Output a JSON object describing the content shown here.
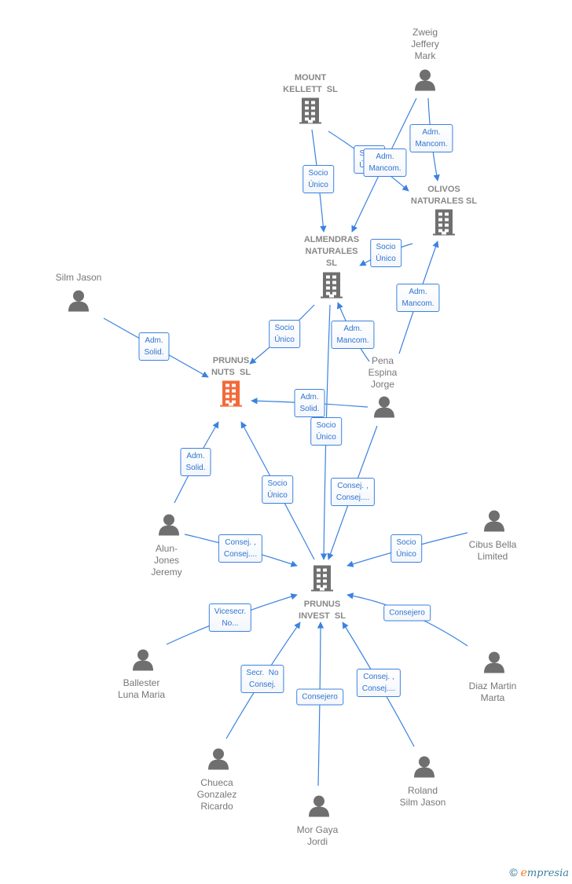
{
  "nodes": [
    {
      "id": "zweig",
      "label": "Zweig\nJeffery\nMark",
      "type": "person"
    },
    {
      "id": "kellett",
      "label": "MOUNT\nKELLETT  SL",
      "type": "company"
    },
    {
      "id": "olivos",
      "label": "OLIVOS\nNATURALES SL",
      "type": "company"
    },
    {
      "id": "almendras",
      "label": "ALMENDRAS\nNATURALES\nSL",
      "type": "company"
    },
    {
      "id": "silm",
      "label": "Silm Jason",
      "type": "person"
    },
    {
      "id": "nuts",
      "label": "PRUNUS\nNUTS  SL",
      "type": "company-main"
    },
    {
      "id": "pena",
      "label": "Pena\nEspina\nJorge",
      "type": "person"
    },
    {
      "id": "alun",
      "label": "Alun-\nJones\nJeremy",
      "type": "person"
    },
    {
      "id": "cibus",
      "label": "Cibus Bella\nLimited",
      "type": "person"
    },
    {
      "id": "invest",
      "label": "PRUNUS\nINVEST  SL",
      "type": "company"
    },
    {
      "id": "ballester",
      "label": "Ballester\nLuna Maria",
      "type": "person"
    },
    {
      "id": "diaz",
      "label": "Diaz Martin\nMarta",
      "type": "person"
    },
    {
      "id": "chueca",
      "label": "Chueca\nGonzalez\nRicardo",
      "type": "person"
    },
    {
      "id": "roland",
      "label": "Roland\nSilm Jason",
      "type": "person"
    },
    {
      "id": "mor",
      "label": "Mor Gaya\nJordi",
      "type": "person"
    }
  ],
  "edges": [
    {
      "from": "kellett",
      "to": "almendras",
      "label": "Socio\nÚnico"
    },
    {
      "from": "kellett",
      "to": "olivos",
      "label": "Socio\nÚnico"
    },
    {
      "from": "zweig",
      "to": "almendras",
      "label": "Adm.\nMancom."
    },
    {
      "from": "zweig",
      "to": "olivos",
      "label": "Adm.\nMancom."
    },
    {
      "from": "olivos",
      "to": "almendras",
      "label": "Socio\nÚnico"
    },
    {
      "from": "pena",
      "to": "olivos",
      "label": "Adm.\nMancom."
    },
    {
      "from": "pena",
      "to": "almendras",
      "label": "Adm.\nMancom."
    },
    {
      "from": "almendras",
      "to": "nuts",
      "label": "Socio\nÚnico"
    },
    {
      "from": "silm",
      "to": "nuts",
      "label": "Adm.\nSolid."
    },
    {
      "from": "pena",
      "to": "nuts",
      "label": "Adm.\nSolid."
    },
    {
      "from": "almendras",
      "to": "invest",
      "label": "Socio\nÚnico"
    },
    {
      "from": "pena",
      "to": "invest",
      "label": "Consej. ,\nConsej...."
    },
    {
      "from": "alun",
      "to": "nuts",
      "label": "Adm.\nSolid."
    },
    {
      "from": "invest",
      "to": "nuts",
      "label": "Socio\nÚnico"
    },
    {
      "from": "alun",
      "to": "invest",
      "label": "Consej. ,\nConsej...."
    },
    {
      "from": "cibus",
      "to": "invest",
      "label": "Socio\nÚnico"
    },
    {
      "from": "ballester",
      "to": "invest",
      "label": "Vicesecr.\nNo..."
    },
    {
      "from": "diaz",
      "to": "invest",
      "label": "Consejero"
    },
    {
      "from": "chueca",
      "to": "invest",
      "label": "Secr.  No\nConsej."
    },
    {
      "from": "mor",
      "to": "invest",
      "label": "Consejero"
    },
    {
      "from": "roland",
      "to": "invest",
      "label": "Consej. ,\nConsej...."
    }
  ],
  "colors": {
    "edge": "#3b82e0",
    "icon": "#6f6f6f",
    "main": "#f26a3a"
  },
  "footer": {
    "copyright": "©",
    "brand": "Empresia"
  }
}
